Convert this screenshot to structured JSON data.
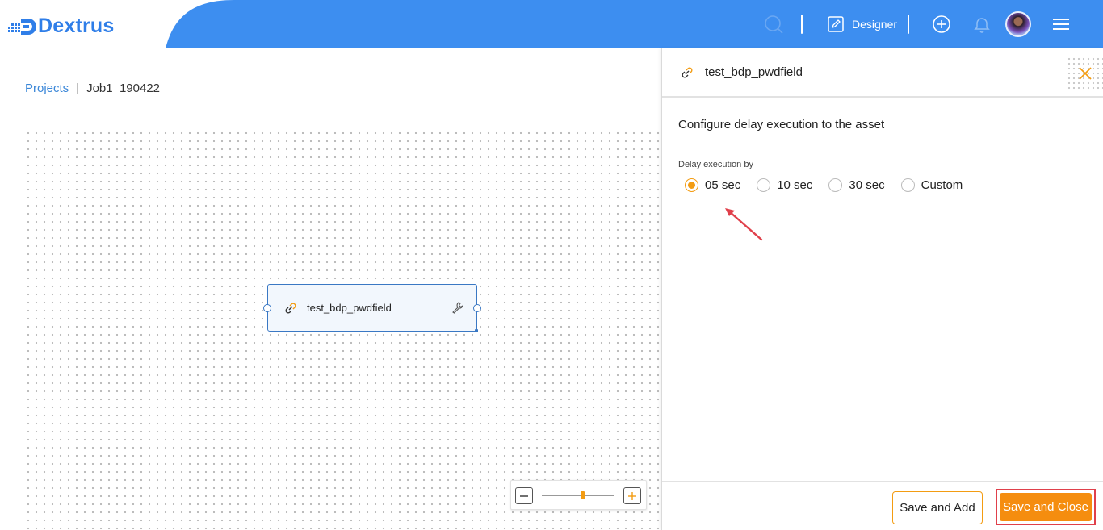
{
  "app": {
    "name": "Dextrus",
    "brand_color": "#2f7ee8",
    "header_color": "#3d8ef0",
    "accent_color": "#f39c12"
  },
  "header": {
    "search_icon": "search-icon",
    "designer_label": "Designer",
    "designer_icon": "edit-icon",
    "add_icon": "plus-circle-icon",
    "notifications_icon": "bell-icon",
    "menu_icon": "hamburger-menu-icon"
  },
  "breadcrumb": {
    "root": "Projects",
    "separator": "|",
    "current": "Job1_190422"
  },
  "canvas": {
    "node": {
      "label": "test_bdp_pwdfield",
      "icon": "link-icon",
      "settings_icon": "wrench-icon"
    },
    "zoom": {
      "minus": "−",
      "plus": "+",
      "level": 0.55
    }
  },
  "panel": {
    "title": "test_bdp_pwdfield",
    "title_icon": "link-icon",
    "close_icon": "close-icon",
    "description": "Configure delay execution to the asset",
    "field_label": "Delay execution by",
    "options": [
      {
        "label": "05 sec",
        "checked": true
      },
      {
        "label": "10 sec",
        "checked": false
      },
      {
        "label": "30 sec",
        "checked": false
      },
      {
        "label": "Custom",
        "checked": false
      }
    ],
    "buttons": {
      "save_add": "Save and Add",
      "save_close": "Save and Close"
    }
  }
}
